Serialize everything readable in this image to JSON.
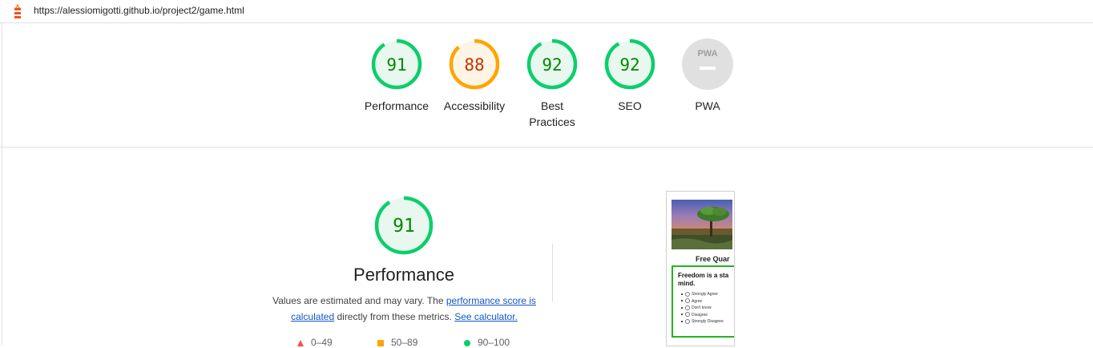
{
  "header": {
    "url": "https://alessiomigotti.github.io/project2/game.html"
  },
  "categories": [
    {
      "id": "performance",
      "score": "91",
      "label": "Performance",
      "color": "#0cce6b",
      "text_color": "#008800",
      "bg": "#e8f8ef",
      "fill": 0.91
    },
    {
      "id": "accessibility",
      "score": "88",
      "label": "Accessibility",
      "color": "#ffa400",
      "text_color": "#c33300",
      "bg": "#fff5e6",
      "fill": 0.88
    },
    {
      "id": "best-practices",
      "score": "92",
      "label": "Best Practices",
      "color": "#0cce6b",
      "text_color": "#008800",
      "bg": "#e8f8ef",
      "fill": 0.92
    },
    {
      "id": "seo",
      "score": "92",
      "label": "SEO",
      "color": "#0cce6b",
      "text_color": "#008800",
      "bg": "#e8f8ef",
      "fill": 0.92
    },
    {
      "id": "pwa",
      "label": "PWA",
      "badge": "PWA",
      "bg": "#e0e0e0"
    }
  ],
  "performance": {
    "score": "91",
    "fill": 0.91,
    "title": "Performance",
    "desc_pre": "Values are estimated and may vary. The ",
    "link_score": "performance score is calculated",
    "desc_mid": " directly from these metrics. ",
    "link_calc": "See calculator."
  },
  "legend": [
    {
      "range": "0–49",
      "shape": "triangle",
      "color": "#ff4e42"
    },
    {
      "range": "50–89",
      "shape": "square",
      "color": "#ffa400"
    },
    {
      "range": "90–100",
      "shape": "circle",
      "color": "#0cce6b"
    }
  ],
  "screenshot": {
    "heading": "Free Quar",
    "question_line1": "Freedom is a sta",
    "question_line2": "mind.",
    "options": [
      "Strongly Agree",
      "Agree",
      "Don't know",
      "Disagree",
      "Strongly Disagree"
    ]
  }
}
